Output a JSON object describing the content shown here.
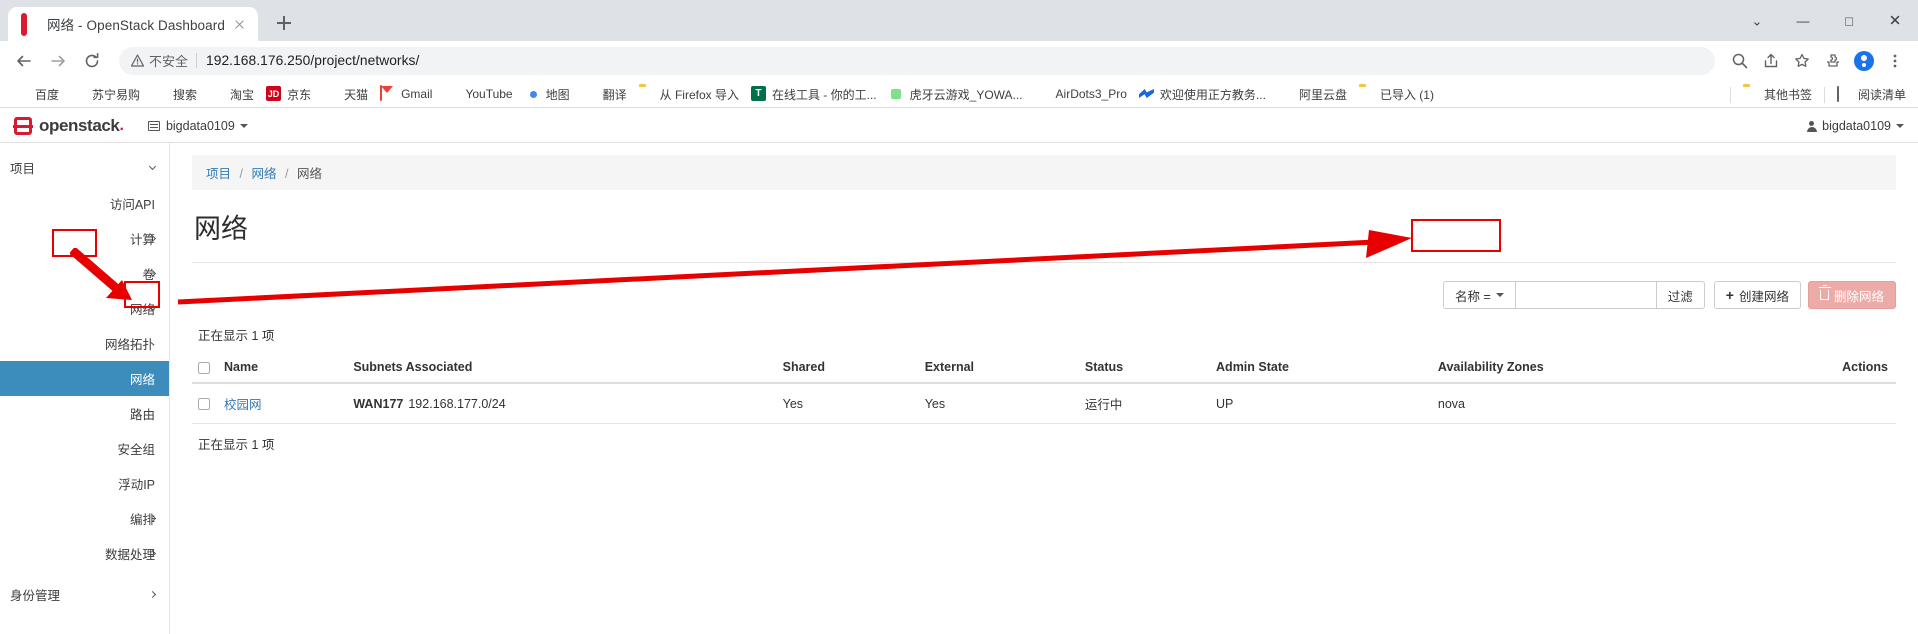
{
  "browser": {
    "tab": {
      "title": "网络 - OpenStack Dashboard",
      "favicon": "openstack-icon",
      "close": "×"
    },
    "newtab_tooltip": "+",
    "window_controls": {
      "minimize": "—",
      "maximize": "□",
      "close": "✕",
      "menu": "⌄"
    },
    "nav": {
      "back": "←",
      "forward": "→",
      "reload": "⟳"
    },
    "omnibox": {
      "security_label": "不安全",
      "url": "192.168.176.250/project/networks/",
      "warning_icon": "warning-triangle-icon"
    },
    "toolbar_icons": [
      "search-icon",
      "share-icon",
      "bookmark-star-icon",
      "extensions-puzzle-icon",
      "profile-avatar-icon",
      "chrome-menu-icon"
    ],
    "bookmarks": [
      {
        "label": "百度",
        "icon": "globe-icon"
      },
      {
        "label": "苏宁易购",
        "icon": "globe-icon"
      },
      {
        "label": "搜索",
        "icon": "globe-icon"
      },
      {
        "label": "淘宝",
        "icon": "globe-icon"
      },
      {
        "label": "京东",
        "icon": "jd-icon"
      },
      {
        "label": "天猫",
        "icon": "globe-icon"
      },
      {
        "label": "Gmail",
        "icon": "gmail-icon"
      },
      {
        "label": "YouTube",
        "icon": "youtube-icon"
      },
      {
        "label": "地图",
        "icon": "chrome-icon"
      },
      {
        "label": "翻译",
        "icon": "baidu-icon"
      },
      {
        "label": "从 Firefox 导入",
        "icon": "folder-icon"
      },
      {
        "label": "在线工具 - 你的工...",
        "icon": "tool-icon"
      },
      {
        "label": "虎牙云游戏_YOWA...",
        "icon": "huya-icon"
      },
      {
        "label": "AirDots3_Pro",
        "icon": "globe-icon"
      },
      {
        "label": "欢迎使用正方教务...",
        "icon": "zhengfang-icon"
      },
      {
        "label": "阿里云盘",
        "icon": "globe-icon"
      },
      {
        "label": "已导入 (1)",
        "icon": "folder-icon"
      }
    ],
    "bookmarks_right": [
      {
        "label": "其他书签",
        "icon": "folder-icon"
      },
      {
        "label": "阅读清单",
        "icon": "reading-list-icon"
      }
    ]
  },
  "dashboard": {
    "brand": "openstack",
    "brand_dot": ".",
    "project_selector": "bigdata0109",
    "user_menu": "bigdata0109",
    "sidebar": {
      "section_title": "项目",
      "items": [
        {
          "label": "访问API",
          "type": "link",
          "indent": true
        },
        {
          "label": "计算",
          "type": "group",
          "chevron": "right"
        },
        {
          "label": "卷",
          "type": "group",
          "chevron": "right"
        },
        {
          "label": "网络",
          "type": "group",
          "chevron": "down"
        },
        {
          "label": "网络拓扑",
          "type": "link",
          "indent": true
        },
        {
          "label": "网络",
          "type": "link",
          "indent": true,
          "active": true
        },
        {
          "label": "路由",
          "type": "link",
          "indent": true
        },
        {
          "label": "安全组",
          "type": "link",
          "indent": true
        },
        {
          "label": "浮动IP",
          "type": "link",
          "indent": true
        },
        {
          "label": "编排",
          "type": "group",
          "chevron": "right"
        },
        {
          "label": "数据处理",
          "type": "group",
          "chevron": "right"
        }
      ],
      "identity_section": {
        "label": "身份管理",
        "chevron": "right"
      }
    },
    "breadcrumb": {
      "root": "项目",
      "mid": "网络",
      "current": "网络",
      "separator": "/"
    },
    "page_title": "网络",
    "toolbar": {
      "filter_field_label": "名称 =",
      "filter_input_value": "",
      "filter_input_placeholder": "",
      "filter_button": "过滤",
      "create_button": "创建网络",
      "create_button_plus": "+",
      "delete_button": "删除网络"
    },
    "count_top": "正在显示 1 项",
    "count_bottom": "正在显示 1 项",
    "table": {
      "columns": [
        "Name",
        "Subnets Associated",
        "Shared",
        "External",
        "Status",
        "Admin State",
        "Availability Zones",
        "Actions"
      ],
      "rows": [
        {
          "name": "校园网",
          "subnet_name": "WAN177",
          "subnet_cidr": "192.168.177.0/24",
          "shared": "Yes",
          "external": "Yes",
          "status": "运行中",
          "admin_state": "UP",
          "availability_zones": "nova",
          "actions": ""
        }
      ]
    }
  },
  "annotations": {
    "color": "#e60000",
    "boxes": [
      {
        "name": "sidebar-network-group-highlight"
      },
      {
        "name": "sidebar-network-item-highlight"
      },
      {
        "name": "create-network-button-highlight"
      }
    ],
    "arrows": [
      {
        "name": "arrow-to-network-menu-item"
      },
      {
        "name": "arrow-to-create-network-button"
      }
    ]
  }
}
